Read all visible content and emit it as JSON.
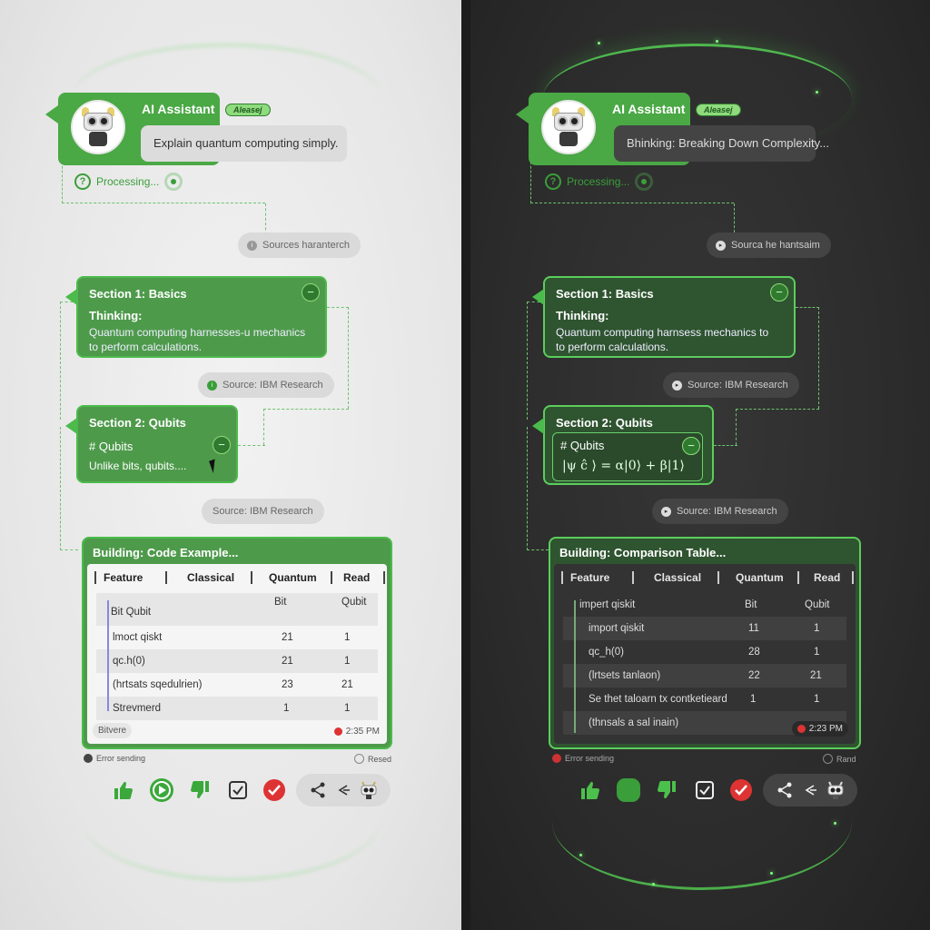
{
  "assistant": {
    "name": "AI Assistant",
    "badge": "Aleasej",
    "processing": "Processing..."
  },
  "light": {
    "query": "Explain quantum computing simply.",
    "source_pill_1": "Sources haranterch",
    "section1": {
      "title": "Section 1: Basics",
      "thinking": "Thinking:",
      "line1": "Quantum computing harnesses-u mechanics",
      "line2": "to perform calculations."
    },
    "source_pill_2": "Source: IBM Research",
    "section2": {
      "title": "Section 2: Qubits",
      "heading": "# Qubits",
      "excerpt": "Unlike bits, qubits...."
    },
    "source_pill_3": "Source: IBM Research",
    "building": {
      "title": "Building: Code Example...",
      "headers": [
        "Feature",
        "Classical",
        "Quantum",
        "Read"
      ],
      "rows": [
        [
          "Bit Qubit",
          "Bit",
          "Qubit"
        ],
        [
          "lmoct qiskt",
          "21",
          "1"
        ],
        [
          "qc.h(0)",
          "21",
          "1"
        ],
        [
          "(hrtsats sqedulrien)",
          "23",
          "21"
        ],
        [
          "Strevmerd",
          "1",
          "1"
        ]
      ],
      "footer": "Bitvere",
      "time": "2:35 PM"
    },
    "error": "Error sending",
    "read": "Resed"
  },
  "dark": {
    "query": "Bhinking: Breaking Down Complexity...",
    "source_pill_1": "Sourca he hantsaim",
    "section1": {
      "title": "Section 1: Basics",
      "thinking": "Thinking:",
      "line1": "Quantum computing harnsess mechanics to",
      "line2": "to perform calculations."
    },
    "source_pill_2": "Source: IBM Research",
    "section2": {
      "title": "Section 2: Qubits",
      "heading": "# Qubits",
      "formula": "|ψ ĉ ⟩ = α|0⟩ + β|1⟩"
    },
    "source_pill_3": "Source: IBM Research",
    "building": {
      "title": "Building: Comparison Table...",
      "headers": [
        "Feature",
        "Classical",
        "Quantum",
        "Read"
      ],
      "rows": [
        [
          "impert qiskit",
          "Bit",
          "Qubit"
        ],
        [
          "import qiskit",
          "11",
          "1"
        ],
        [
          "qc_h(0)",
          "28",
          "1"
        ],
        [
          "(lrtsets tanlaon)",
          "22",
          "21"
        ],
        [
          "Se thet taloarn tx contketieard",
          "1",
          "1"
        ],
        [
          "(thnsals a sal inain)",
          "",
          ""
        ]
      ],
      "time": "2:23 PM"
    },
    "error": "Error sending",
    "read": "Rand"
  },
  "colors": {
    "accent": "#4aa845",
    "dark_accent": "#5ccd5c",
    "error": "#d33333"
  },
  "icons": [
    "thumbs-up-icon",
    "play-icon",
    "thumbs-down-icon",
    "checkbox-icon",
    "check-circle-icon",
    "share-icon",
    "reply-icon",
    "robot-icon"
  ]
}
